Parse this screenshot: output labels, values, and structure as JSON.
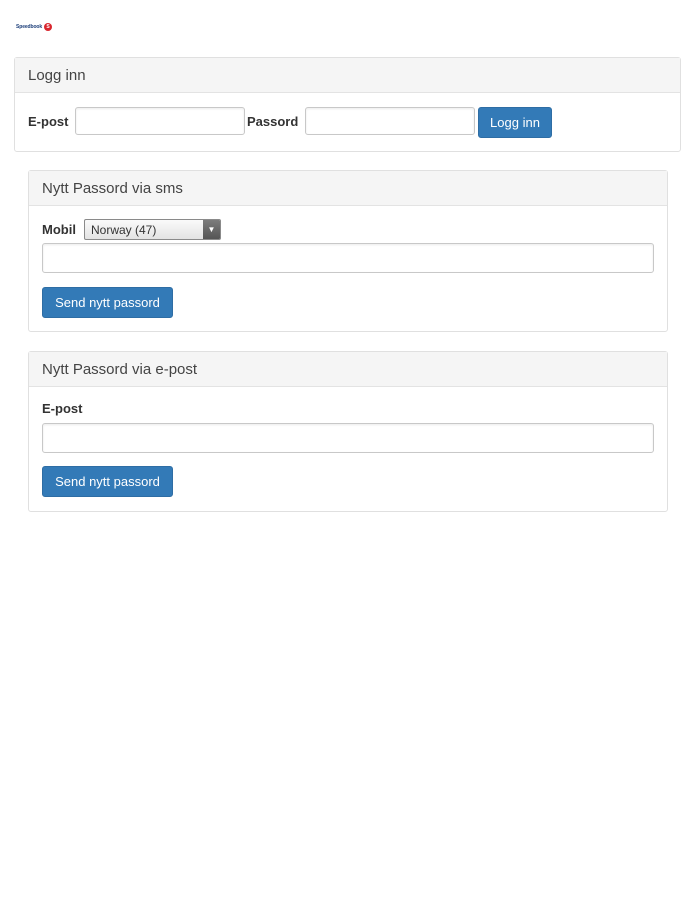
{
  "logo": {
    "text": "Speedbook",
    "mark": "S"
  },
  "login": {
    "title": "Logg inn",
    "email_label": "E-post",
    "email_value": "",
    "password_label": "Passord",
    "password_value": "",
    "submit_label": "Logg inn"
  },
  "sms_reset": {
    "title": "Nytt Passord via sms",
    "mobile_label": "Mobil",
    "country_selected": "Norway (47)",
    "phone_value": "",
    "submit_label": "Send nytt passord"
  },
  "email_reset": {
    "title": "Nytt Passord via e-post",
    "email_label": "E-post",
    "email_value": "",
    "submit_label": "Send nytt passord"
  },
  "colors": {
    "primary_button": "#337ab7",
    "panel_heading_bg": "#f5f5f5",
    "logo_accent": "#d9262e"
  }
}
